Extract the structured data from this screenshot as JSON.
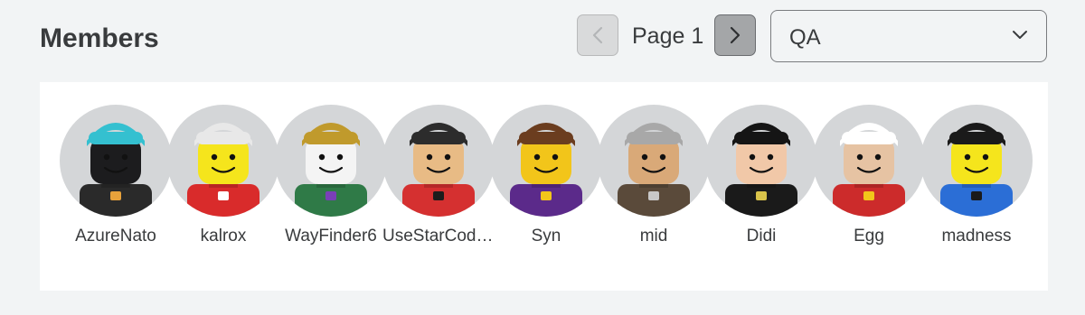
{
  "section": {
    "title": "Members"
  },
  "pager": {
    "page_label": "Page 1"
  },
  "role_select": {
    "selected": "QA"
  },
  "members": [
    {
      "name": "AzureNato",
      "skin": "#1c1c1e",
      "torso": "#2a2a2a",
      "accent": "#e8a23b",
      "hair": "#34c0d0"
    },
    {
      "name": "kalrox",
      "skin": "#f5e51c",
      "torso": "#d92b2b",
      "accent": "#ffffff",
      "hair": "#e8e8e8"
    },
    {
      "name": "WayFinder6",
      "skin": "#f4f4f4",
      "torso": "#2f7a47",
      "accent": "#7a3fb8",
      "hair": "#c09a2c"
    },
    {
      "name": "UseStarCode…",
      "skin": "#e8bb85",
      "torso": "#d53030",
      "accent": "#1c1c1c",
      "hair": "#2c2c2c"
    },
    {
      "name": "Syn",
      "skin": "#f2c51a",
      "torso": "#5b2a8a",
      "accent": "#f2c51a",
      "hair": "#6b3d1f"
    },
    {
      "name": "mid",
      "skin": "#d9a978",
      "torso": "#5a4a3a",
      "accent": "#c8c8c8",
      "hair": "#a8a8a8"
    },
    {
      "name": "Didi",
      "skin": "#f1c8a8",
      "torso": "#1a1a1a",
      "accent": "#d9c34a",
      "hair": "#151515"
    },
    {
      "name": "Egg",
      "skin": "#e6c3a3",
      "torso": "#cc2b2b",
      "accent": "#f2c51a",
      "hair": "#ffffff"
    },
    {
      "name": "madness",
      "skin": "#f5e51c",
      "torso": "#2b6ed6",
      "accent": "#1a1a1a",
      "hair": "#1a1a1a"
    }
  ]
}
